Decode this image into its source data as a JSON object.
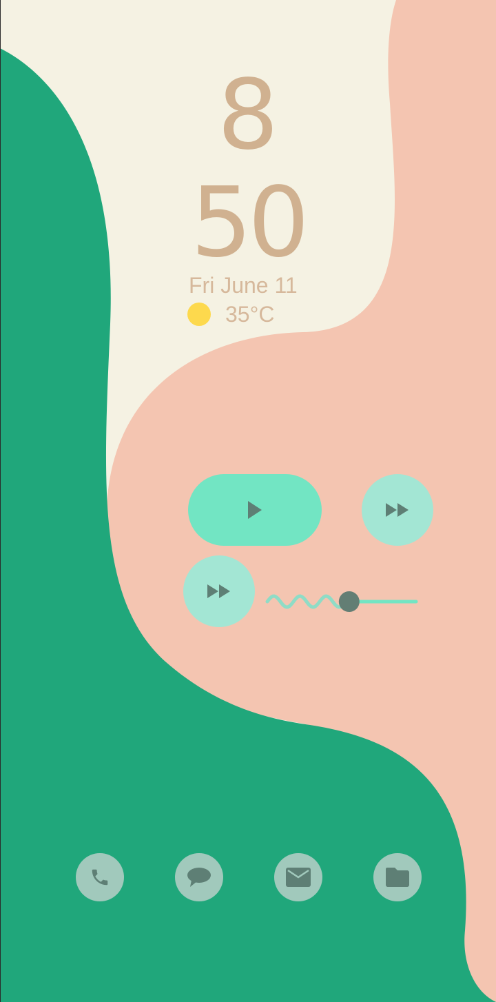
{
  "colors": {
    "background_cream": "#f5f2e3",
    "wave_green": "#20a77b",
    "wave_peach": "#f4c5b1",
    "clock_text": "#d0b190",
    "sun": "#fdd94d",
    "media_accent": "#72e5c3",
    "media_secondary": "#a3e6d4",
    "icon_dark": "#5e7f75",
    "dock_button": "#a1c9bc"
  },
  "lockscreen": {
    "clock": {
      "hour": "8",
      "minute": "50"
    },
    "date": "Fri June 11",
    "weather": {
      "icon": "sun-icon",
      "temperature": "35°C"
    }
  },
  "media": {
    "play_icon": "play-icon",
    "fast_forward_icon": "fast-forward-icon",
    "progress_fraction": 0.55
  },
  "dock": {
    "items": [
      {
        "name": "phone",
        "icon": "phone-icon"
      },
      {
        "name": "messages",
        "icon": "chat-bubble-icon"
      },
      {
        "name": "email",
        "icon": "mail-icon"
      },
      {
        "name": "files",
        "icon": "folder-icon"
      }
    ]
  }
}
